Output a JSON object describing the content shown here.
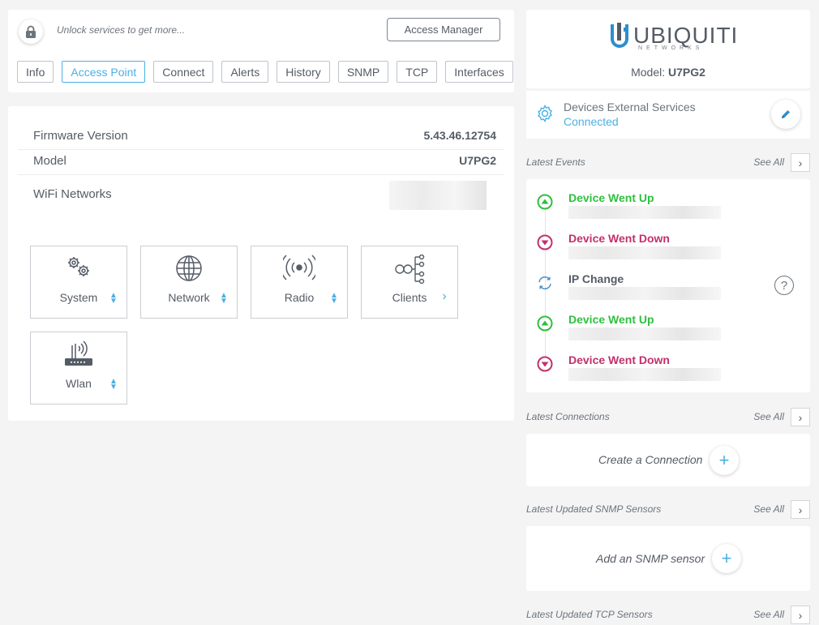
{
  "top": {
    "unlock_text": "Unlock services to get more...",
    "access_manager_label": "Access Manager",
    "tabs": [
      {
        "label": "Info",
        "active": false
      },
      {
        "label": "Access Point",
        "active": true
      },
      {
        "label": "Connect",
        "active": false
      },
      {
        "label": "Alerts",
        "active": false
      },
      {
        "label": "History",
        "active": false
      },
      {
        "label": "SNMP",
        "active": false
      },
      {
        "label": "TCP",
        "active": false
      },
      {
        "label": "Interfaces",
        "active": false
      }
    ]
  },
  "info": {
    "firmware_label": "Firmware Version",
    "firmware_value": "5.43.46.12754",
    "model_label": "Model",
    "model_value": "U7PG2",
    "wifi_label": "WiFi Networks"
  },
  "tiles": [
    {
      "label": "System",
      "icon": "gears-icon",
      "arrow": "updown"
    },
    {
      "label": "Network",
      "icon": "globe-icon",
      "arrow": "updown"
    },
    {
      "label": "Radio",
      "icon": "radio-signal-icon",
      "arrow": "updown"
    },
    {
      "label": "Clients",
      "icon": "clients-network-icon",
      "arrow": "right"
    },
    {
      "label": "Wlan",
      "icon": "wifi-router-icon",
      "arrow": "updown"
    }
  ],
  "device": {
    "brand": "UBIQUITI",
    "brand_sub": "NETWORKS",
    "model_prefix": "Model:",
    "model_value": "U7PG2"
  },
  "services": {
    "title": "Devices External Services",
    "status": "Connected"
  },
  "sections": {
    "events": "Latest Events",
    "connections": "Latest Connections",
    "snmp": "Latest Updated SNMP Sensors",
    "tcp": "Latest Updated TCP Sensors",
    "see_all": "See All"
  },
  "events": [
    {
      "title": "Device Went Up",
      "type": "up"
    },
    {
      "title": "Device Went Down",
      "type": "down"
    },
    {
      "title": "IP Change",
      "type": "change"
    },
    {
      "title": "Device Went Up",
      "type": "up"
    },
    {
      "title": "Device Went Down",
      "type": "down"
    }
  ],
  "actions": {
    "create_connection": "Create a Connection",
    "add_snmp": "Add an SNMP sensor"
  },
  "colors": {
    "accent": "#4ab0e4",
    "up": "#2fbf3f",
    "down": "#c2306b",
    "change": "#4a8ec4"
  }
}
